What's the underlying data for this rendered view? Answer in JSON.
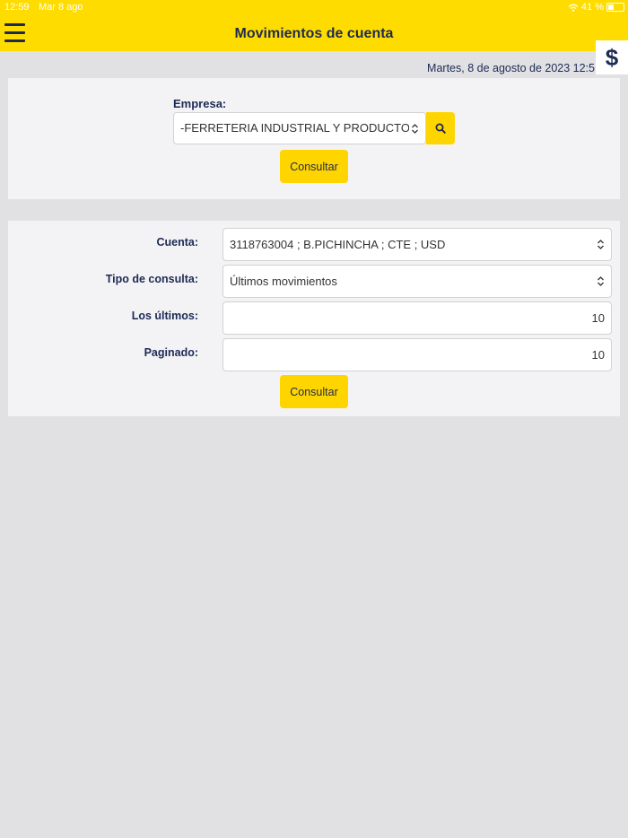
{
  "status_bar": {
    "time": "12:59",
    "date": "Mar 8 ago",
    "battery": "41 %"
  },
  "header": {
    "title": "Movimientos de cuenta",
    "currency_symbol": "$"
  },
  "datetime": "Martes, 8 de agosto de 2023 12:5",
  "empresa": {
    "label": "Empresa:",
    "selected": "-FERRETERIA INDUSTRIAL Y PRODUCTOS",
    "button_label": "Consultar"
  },
  "consulta": {
    "cuenta_label": "Cuenta:",
    "cuenta_value": "3118763004 ; B.PICHINCHA ; CTE ; USD",
    "tipo_label": "Tipo de consulta:",
    "tipo_value": "Últimos movimientos",
    "ultimos_label": "Los últimos:",
    "ultimos_value": "10",
    "paginado_label": "Paginado:",
    "paginado_value": "10",
    "button_label": "Consultar"
  },
  "colors": {
    "brand_yellow": "#ffdc00",
    "navy": "#1d2a54",
    "background": "#e1e1e3"
  }
}
